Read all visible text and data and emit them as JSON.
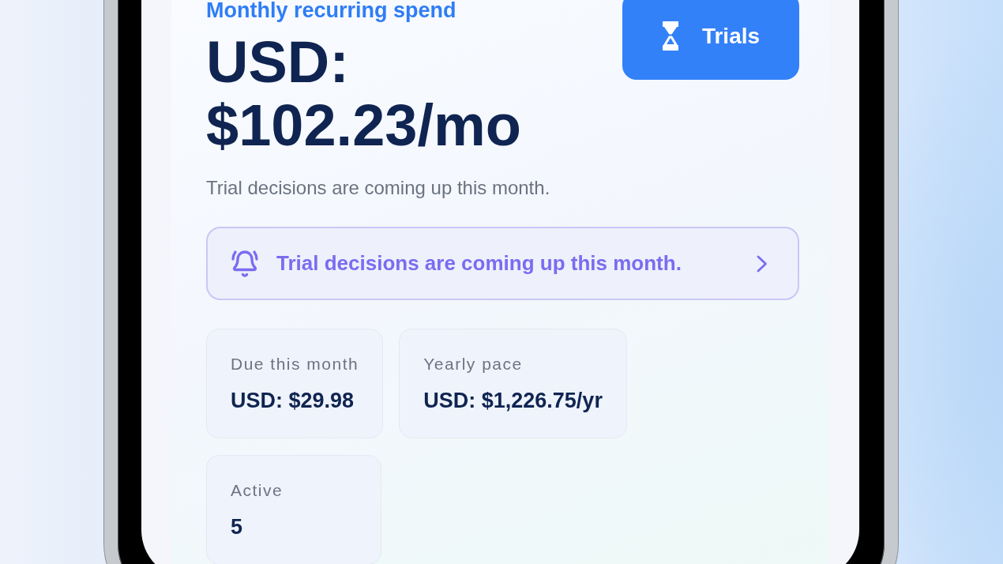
{
  "header": {
    "title": "Monthly recurring spend",
    "amount": "USD: $102.23/mo",
    "subtitle": "Trial decisions are coming up this month."
  },
  "trials_button": {
    "label": "Trials"
  },
  "alert": {
    "message": "Trial decisions are coming up this month."
  },
  "stats": [
    {
      "label": "Due this month",
      "value": "USD: $29.98"
    },
    {
      "label": "Yearly pace",
      "value": "USD: $1,226.75/yr"
    },
    {
      "label": "Active",
      "value": "5"
    }
  ]
}
